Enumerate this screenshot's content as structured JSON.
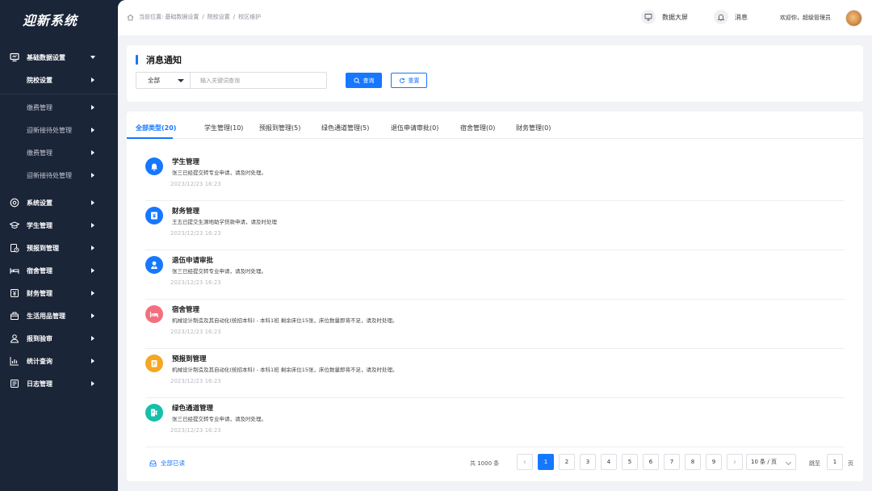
{
  "app": {
    "logo": "迎新系统"
  },
  "sidebar": {
    "items": [
      {
        "label": "基础数据设置",
        "icon": "monitor-icon",
        "expanded": true
      },
      {
        "label": "系统设置",
        "icon": "settings-circle-icon"
      },
      {
        "label": "学生管理",
        "icon": "graduation-cap-icon"
      },
      {
        "label": "预报到管理",
        "icon": "clipboard-clock-icon"
      },
      {
        "label": "宿舍管理",
        "icon": "bed-icon"
      },
      {
        "label": "财务管理",
        "icon": "finance-icon"
      },
      {
        "label": "生活用品管理",
        "icon": "gift-box-icon"
      },
      {
        "label": "报到验审",
        "icon": "user-check-icon"
      },
      {
        "label": "统计查询",
        "icon": "bar-chart-icon"
      },
      {
        "label": "日志管理",
        "icon": "document-list-icon"
      }
    ],
    "sub_items": [
      {
        "label": "院校设置",
        "active": true
      },
      {
        "label": "缴费管理"
      },
      {
        "label": "迎新接待处管理"
      },
      {
        "label": "缴费管理"
      },
      {
        "label": "迎新接待处管理"
      }
    ]
  },
  "header": {
    "breadcrumb_prefix": "当前位置:",
    "breadcrumb": [
      "基础数据设置",
      "院校设置",
      "校区维护"
    ],
    "breadcrumb_sep": "/",
    "data_screen_label": "数据大屏",
    "messages_label": "消息",
    "welcome": "欢迎你，超级管理员"
  },
  "notice": {
    "title": "消息通知",
    "filter_selected": "全部",
    "search_placeholder": "输入关键词查询",
    "search_button": "查询",
    "reset_button": "重置"
  },
  "tabs": [
    {
      "label": "全部类型(20)",
      "active": true
    },
    {
      "label": "学生管理(10)"
    },
    {
      "label": "预报到管理(5)"
    },
    {
      "label": "绿色通道管理(5)"
    },
    {
      "label": "退伍申请审批(0)"
    },
    {
      "label": "宿舍管理(0)"
    },
    {
      "label": "财务管理(0)"
    }
  ],
  "messages": [
    {
      "title": "学生管理",
      "desc": "张三已经提交转专业申请，请及时处理。",
      "time": "2023/12/23 16:23",
      "icon": "bell-icon",
      "color": "#1677ff"
    },
    {
      "title": "财务管理",
      "desc": "王五已提交生源地助学贷款申请，请及时处理",
      "time": "2023/12/23 16:23",
      "icon": "finance-icon",
      "color": "#1677ff"
    },
    {
      "title": "退伍申请审批",
      "desc": "张三已经提交转专业申请，请及时处理。",
      "time": "2023/12/23 16:23",
      "icon": "soldier-icon",
      "color": "#1677ff"
    },
    {
      "title": "宿舍管理",
      "desc": "机械设计制造及其自动化(统招本科) - 本科1班 剩余床位15张，床位数量即将不足，请及时处理。",
      "time": "2023/12/23 16:23",
      "icon": "bed-icon",
      "color": "#f46f7e"
    },
    {
      "title": "预报到管理",
      "desc": "机械设计制造及其自动化(统招本科) - 本科1班 剩余床位15张，床位数量即将不足，请及时处理。",
      "time": "2023/12/23 16:23",
      "icon": "clipboard-icon",
      "color": "#f5a623"
    },
    {
      "title": "绿色通道管理",
      "desc": "张三已经提交转专业申请，请及时处理。",
      "time": "2023/12/23 16:23",
      "icon": "green-channel-icon",
      "color": "#16bfa8"
    }
  ],
  "footer": {
    "mark_all_read": "全部已读",
    "total": "共 1000 条",
    "pages": [
      "1",
      "2",
      "3",
      "4",
      "5",
      "6",
      "7",
      "8",
      "9"
    ],
    "current_page": "1",
    "page_size": "10 条 / 页",
    "jump_prefix": "跳至",
    "jump_value": "1",
    "jump_suffix": "页"
  },
  "colors": {
    "primary": "#1677ff",
    "sidebar_bg": "#1b2538",
    "page_bg": "#f1f3f6"
  }
}
